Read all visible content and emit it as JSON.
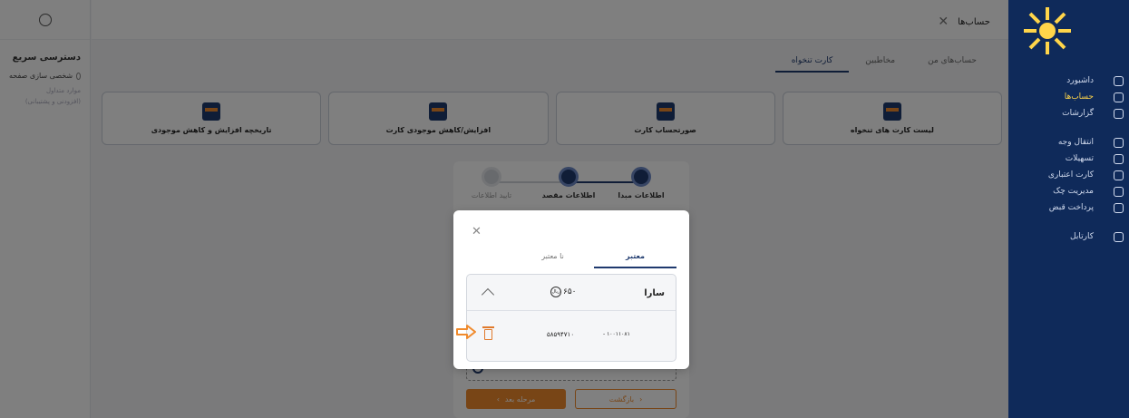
{
  "header": {
    "title": "حساب‌ها"
  },
  "sidebar": {
    "items": [
      {
        "label": "داشبورد",
        "icon": "dashboard-icon",
        "active": false
      },
      {
        "label": "حساب‌ها",
        "icon": "accounts-icon",
        "active": true
      },
      {
        "label": "گزارشات",
        "icon": "reports-icon",
        "active": false
      },
      {
        "label": "انتقال وجه",
        "icon": "transfer-icon",
        "active": false
      },
      {
        "label": "تسهیلات",
        "icon": "facilities-icon",
        "active": false
      },
      {
        "label": "کارت اعتباری",
        "icon": "credit-card-icon",
        "active": false
      },
      {
        "label": "مدیریت چک",
        "icon": "check-icon",
        "active": false
      },
      {
        "label": "پرداخت قبض",
        "icon": "bill-icon",
        "active": false
      },
      {
        "label": "کارتابل",
        "icon": "cartable-icon",
        "active": false
      }
    ]
  },
  "quick_access": {
    "title": "دسترسی سریع",
    "customize": "شخصی سازی صفحه",
    "sub1": "موارد متداول",
    "sub2": "(افزودنی و پشتیبانی)"
  },
  "tabs": [
    {
      "label": "حساب‌های من",
      "active": false
    },
    {
      "label": "مخاطبین",
      "active": false
    },
    {
      "label": "کارت تنخواه",
      "active": true
    }
  ],
  "cards": [
    {
      "label": "لیست کارت های تنخواه"
    },
    {
      "label": "صورتحساب کارت"
    },
    {
      "label": "افزایش/کاهش موجودی کارت"
    },
    {
      "label": "تاریخچه افزایش و کاهش موجودی"
    }
  ],
  "wizard": {
    "steps": [
      {
        "label": "اطلاعات مبدا",
        "active": true
      },
      {
        "label": "اطلاعات مقصد",
        "active": true
      },
      {
        "label": "تایید اطلاعات",
        "active": false
      }
    ],
    "next_label": "مرحله بعد",
    "back_label": "بازگشت"
  },
  "modal": {
    "tabs": [
      {
        "label": "معتبر",
        "active": true
      },
      {
        "label": "نا معتبر",
        "active": false
      }
    ],
    "item": {
      "name": "سارا",
      "amount": "۶۵۰",
      "currency": "ریال",
      "card_number": "۵۸۵۹۴۷۱۰",
      "account_number": "- ۱۰۰۱۱۰۸۱"
    }
  },
  "colors": {
    "primary": "#1f3a6e",
    "accent": "#f08a2c",
    "sidebar_bg": "#0f2a5a"
  }
}
